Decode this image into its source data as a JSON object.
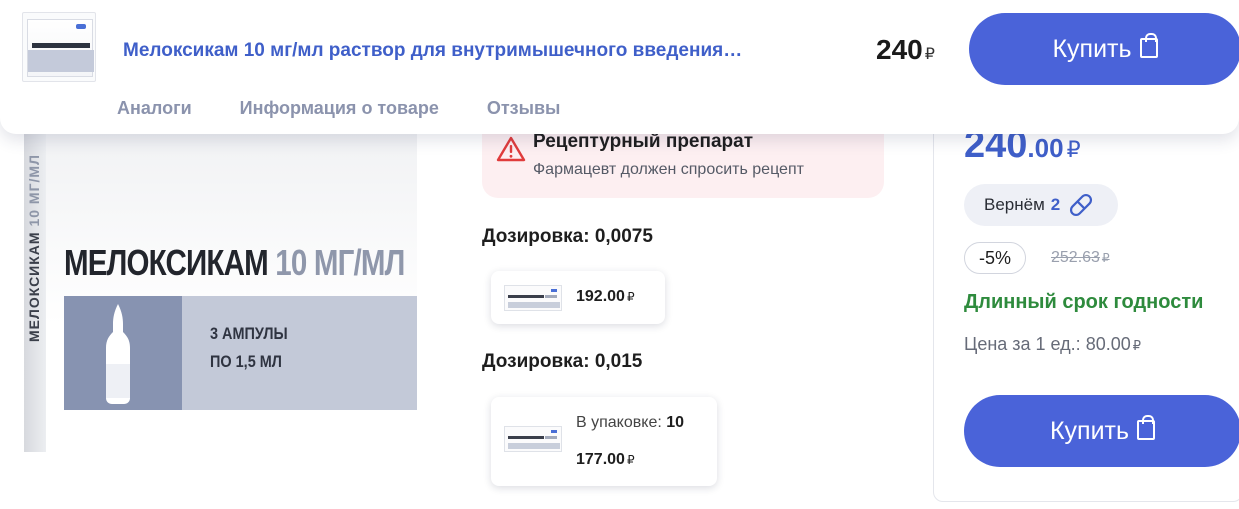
{
  "header": {
    "product_title": "Мелоксикам 10 мг/мл раствор для внутримышечного введения…",
    "price": "240",
    "currency": "₽",
    "buy_label": "Купить",
    "tabs": [
      {
        "label": "Аналоги"
      },
      {
        "label": "Информация о товаре"
      },
      {
        "label": "Отзывы"
      }
    ]
  },
  "product_image": {
    "name": "МЕЛОКСИКАМ",
    "dose": "10 МГ/МЛ",
    "package_line1": "3 АМПУЛЫ",
    "package_line2": "ПО 1,5 МЛ"
  },
  "prescription": {
    "title": "Рецептурный препарат",
    "subtitle": "Фармацевт должен спросить рецепт"
  },
  "dosages": [
    {
      "label": "Дозировка:",
      "value": "0,0075",
      "variants": [
        {
          "price": "192.00",
          "currency": "₽"
        }
      ]
    },
    {
      "label": "Дозировка:",
      "value": "0,015",
      "variants": [
        {
          "pack_label": "В упаковке:",
          "pack_count": "10",
          "price": "177.00",
          "currency": "₽"
        }
      ]
    }
  ],
  "price_block": {
    "price_int": "240",
    "price_dec": ".00",
    "currency": "₽",
    "cashback_label": "Вернём",
    "cashback_value": "2",
    "discount": "-5%",
    "old_price": "252.63",
    "expiry_text": "Длинный срок годности",
    "unit_price_label": "Цена за 1 ед.:",
    "unit_price_value": "80.00",
    "buy_label": "Купить"
  },
  "colors": {
    "accent": "#4a63d9",
    "title_blue": "#3f5fc9",
    "success": "#2e8b3d",
    "warning_bg": "#fdeff1",
    "warning_icon": "#e03c3c"
  }
}
